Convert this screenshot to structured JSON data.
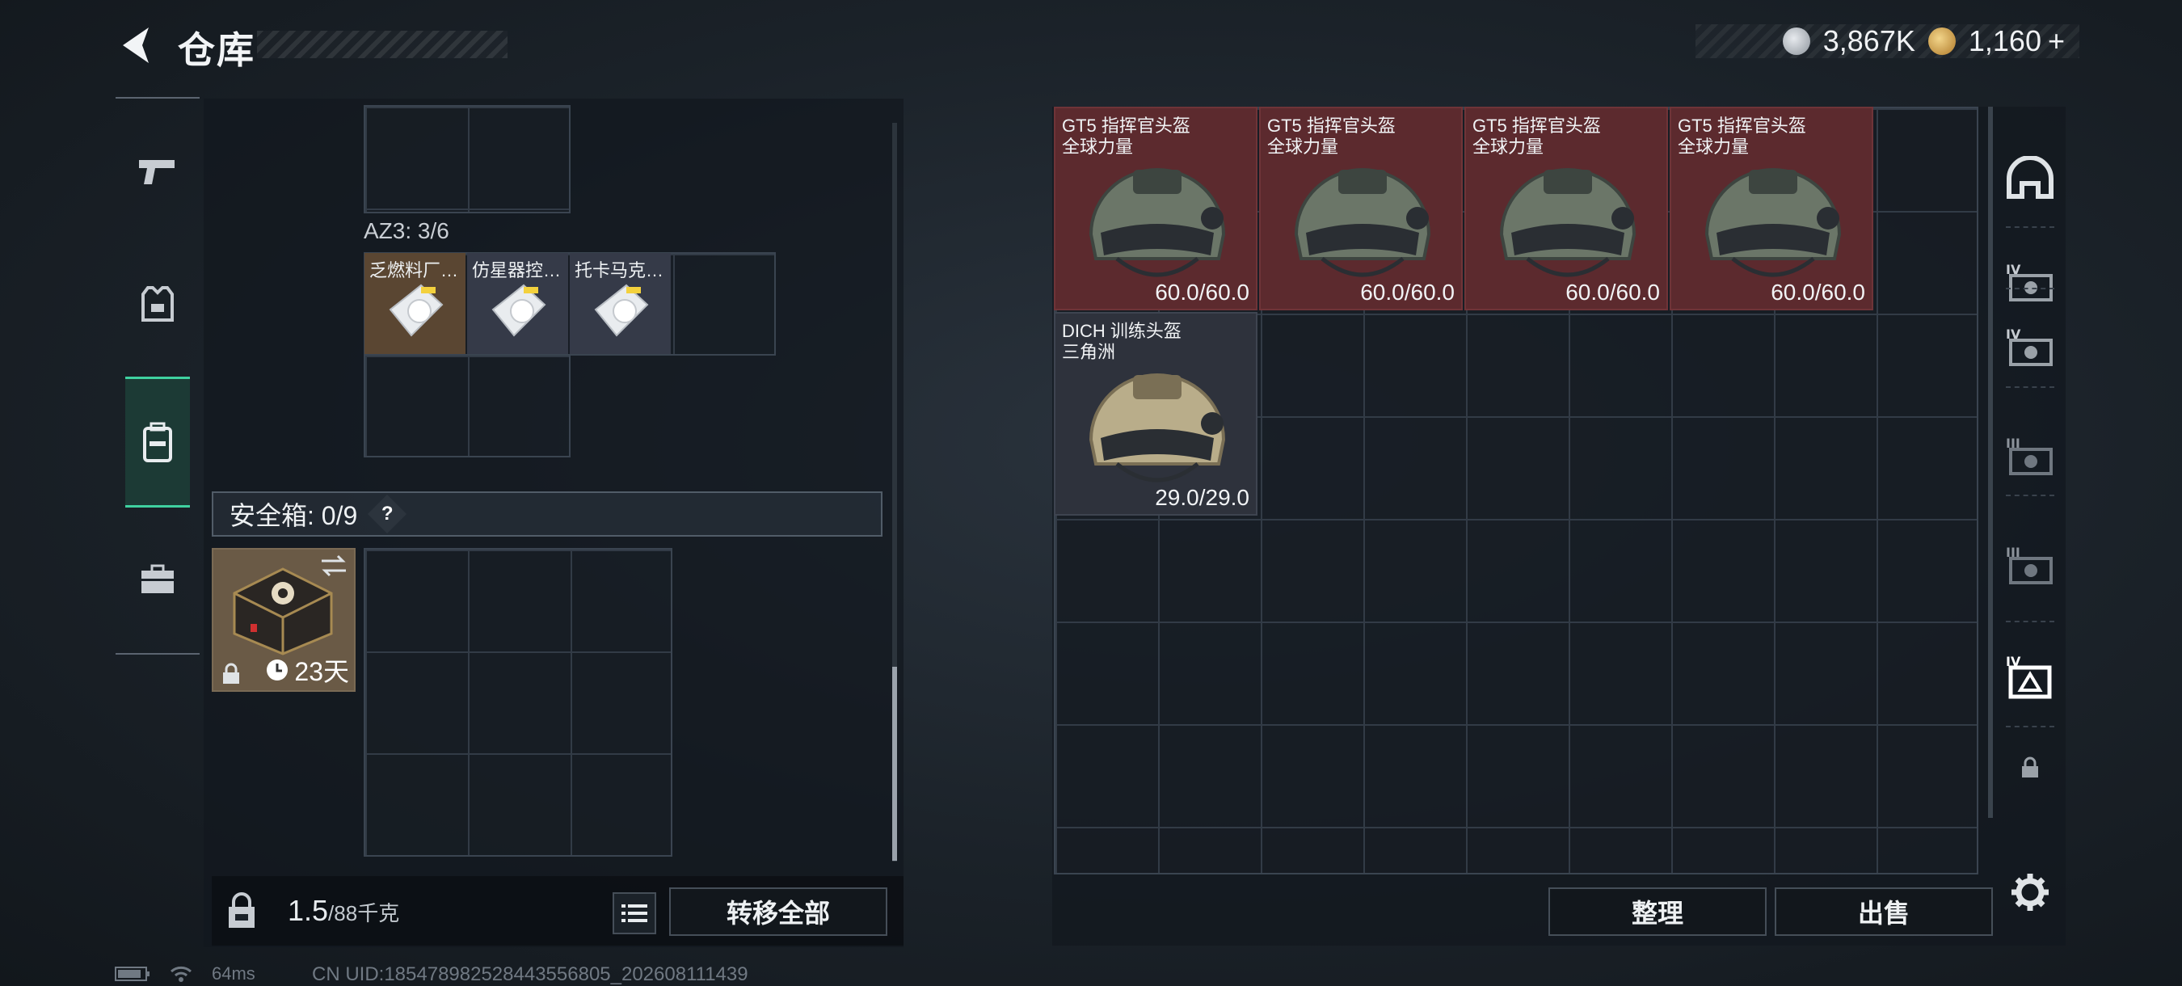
{
  "header": {
    "title": "仓库",
    "currency_silver": "3,867K",
    "currency_gold": "1,160",
    "currency_plus": "+"
  },
  "left_nav": {
    "items": [
      {
        "icon": "pistol-icon"
      },
      {
        "icon": "armor-vest-icon"
      },
      {
        "icon": "backpack-icon",
        "active": true
      },
      {
        "icon": "briefcase-icon"
      }
    ]
  },
  "backpack": {
    "az3_label": "AZ3: 3/6",
    "az3_items": [
      "乏燃料厂…",
      "仿星器控…",
      "托卡马克…"
    ]
  },
  "safe_box": {
    "label": "安全箱: 0/9",
    "help": "?",
    "duration": "23天"
  },
  "weight": {
    "current": "1.5",
    "max": "/88千克"
  },
  "buttons": {
    "transfer_all": "转移全部",
    "sort": "整理",
    "sell": "出售"
  },
  "stash_items": [
    {
      "line1": "GT5 指挥官头盔",
      "line2": "全球力量",
      "durability": "60.0/60.0",
      "rarity": "red"
    },
    {
      "line1": "GT5 指挥官头盔",
      "line2": "全球力量",
      "durability": "60.0/60.0",
      "rarity": "red"
    },
    {
      "line1": "GT5 指挥官头盔",
      "line2": "全球力量",
      "durability": "60.0/60.0",
      "rarity": "red"
    },
    {
      "line1": "GT5 指挥官头盔",
      "line2": "全球力量",
      "durability": "60.0/60.0",
      "rarity": "red"
    },
    {
      "line1": "DICH 训练头盔",
      "line2": "三角洲",
      "durability": "29.0/29.0",
      "rarity": "gray"
    }
  ],
  "right_nav": {
    "items": [
      "helmet-category-icon",
      "tier-iv-case-icon",
      "tier-iv-case-icon",
      "tier-iii-case-icon",
      "tier-iii-case-icon",
      "tier-iv-helmet-case-icon",
      "lock-icon"
    ],
    "tier_labels": [
      "IV",
      "IV",
      "III",
      "III",
      "IV"
    ]
  },
  "footer": {
    "ping": "64ms",
    "uid": "CN UID:18547898252844355680​5_202608111439"
  },
  "colors": {
    "accent": "#3fd1a0",
    "red_rarity": "#5c2a2e",
    "gray_rarity": "#2e323c"
  }
}
